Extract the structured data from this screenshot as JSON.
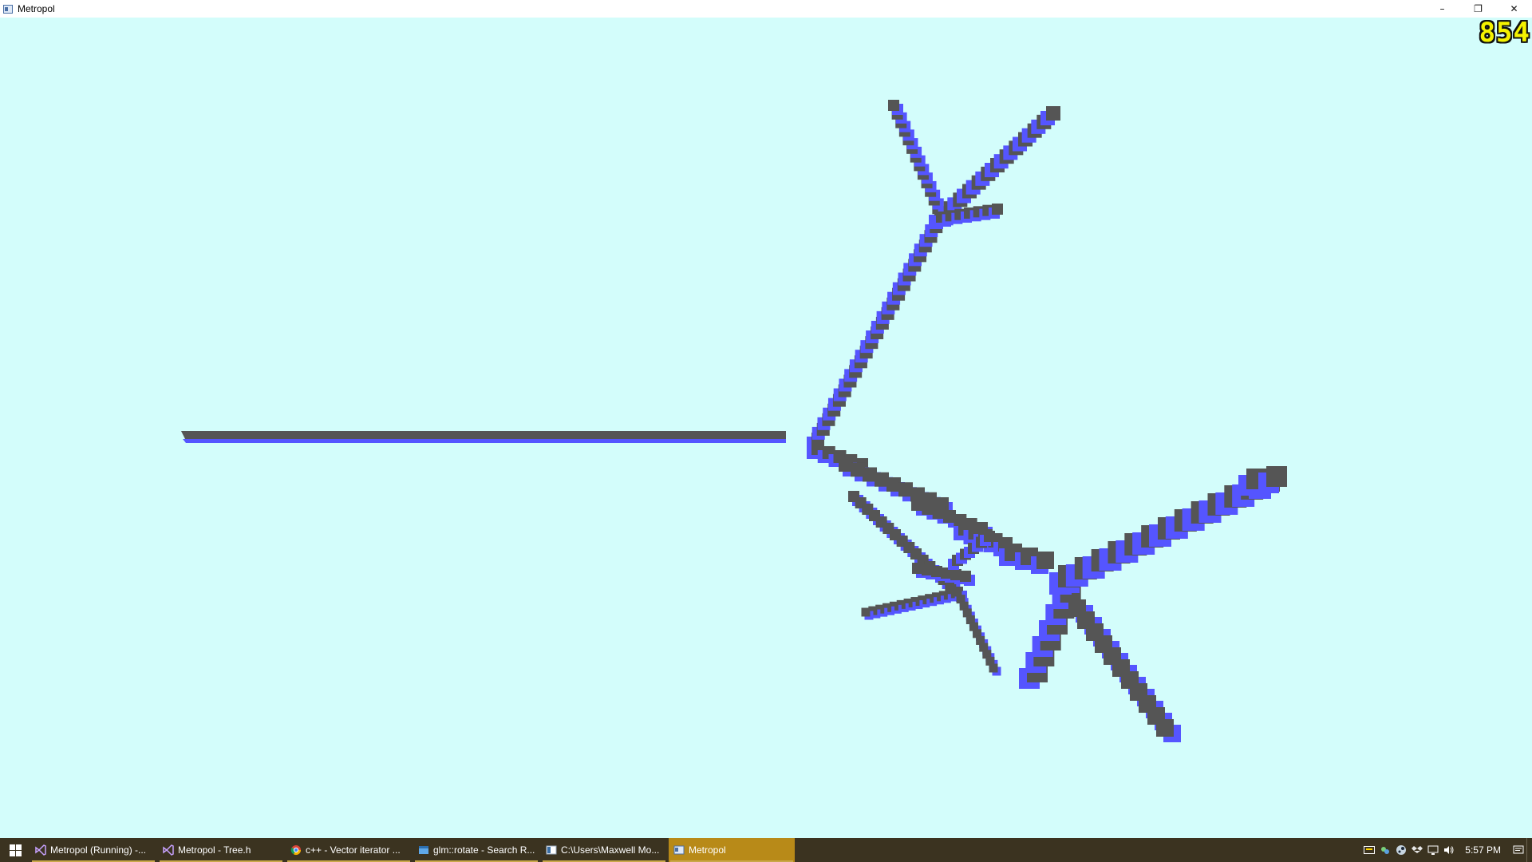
{
  "window": {
    "title": "Metropol",
    "controls": {
      "minimize": "–",
      "restore": "❐",
      "close": "✕"
    }
  },
  "viewport": {
    "fps": "854",
    "colors": {
      "sky": "#d3fdfb",
      "top_face": "#555555",
      "side_face": "#5555ff",
      "fps_text": "#f4f200"
    }
  },
  "taskbar": {
    "items": [
      {
        "label": "Metropol (Running) -...",
        "icon": "visual-studio-icon",
        "active": false
      },
      {
        "label": "Metropol - Tree.h",
        "icon": "visual-studio-icon",
        "active": false
      },
      {
        "label": "c++ - Vector iterator ...",
        "icon": "chrome-icon",
        "active": false
      },
      {
        "label": "glm::rotate - Search R...",
        "icon": "browser-icon",
        "active": false
      },
      {
        "label": "C:\\Users\\Maxwell Mo...",
        "icon": "explorer-icon",
        "active": false
      },
      {
        "label": "Metropol",
        "icon": "app-window-icon",
        "active": true
      }
    ],
    "tray": {
      "icons": [
        "keyboard-icon",
        "network-app-icon",
        "steam-icon",
        "dropbox-icon",
        "network-icon",
        "volume-icon",
        "notification-icon"
      ],
      "clock": "5:57 PM"
    }
  }
}
